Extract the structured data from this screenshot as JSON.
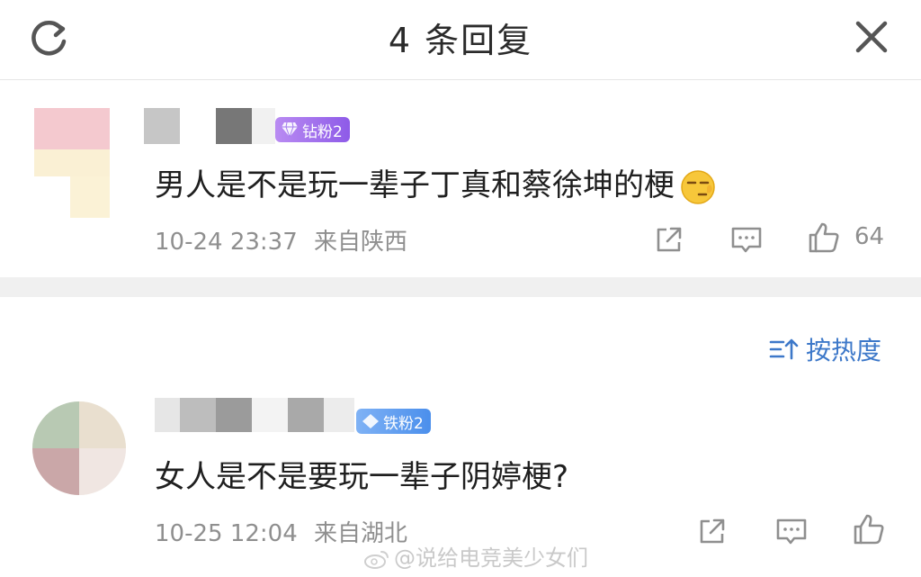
{
  "header": {
    "title": "4 条回复",
    "refresh_icon": "refresh-icon",
    "close_icon": "close-icon"
  },
  "comments": [
    {
      "badge": "钻粉2",
      "text": "男人是不是玩一辈子丁真和蔡徐坤的梗",
      "emoji": "smirk-face-emoji",
      "date": "10-24 23:37",
      "location": "来自陕西",
      "likes": "64"
    },
    {
      "badge": "铁粉2",
      "text": "女人是不是要玩一辈子阴婷梗?",
      "date": "10-25 12:04",
      "location": "来自湖北"
    }
  ],
  "sort": {
    "label": "按热度",
    "icon": "sort-icon"
  },
  "watermark": "@说给电竞美少女们",
  "colors": {
    "accent_blue": "#3d78c9",
    "meta_gray": "#8f8f8f",
    "diamond_badge": "#9a67ea",
    "iron_badge": "#4b8fec"
  }
}
